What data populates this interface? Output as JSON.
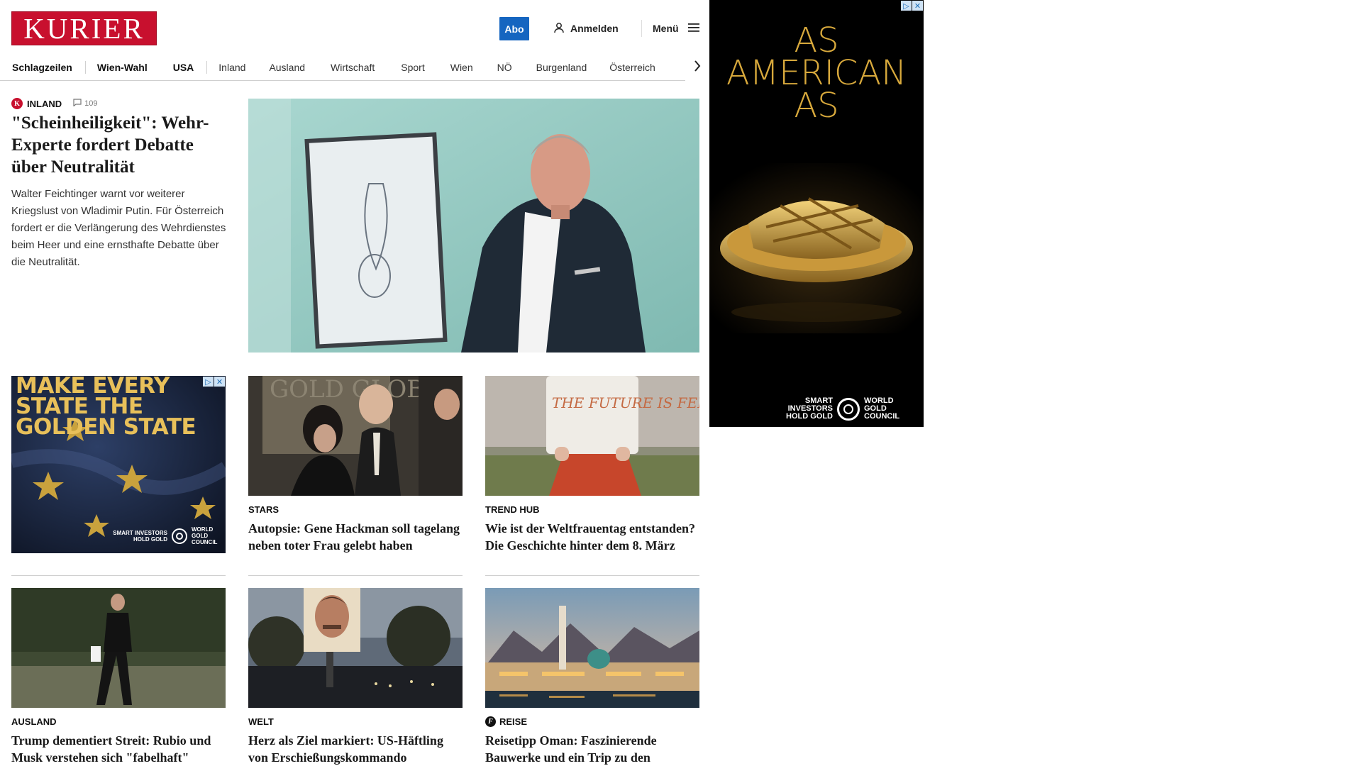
{
  "header": {
    "logo": "KURIER",
    "abo_label": "Abo",
    "login_label": "Anmelden",
    "menu_label": "Menü"
  },
  "nav": {
    "items": [
      "Schlagzeilen",
      "Wien-Wahl",
      "USA",
      "Inland",
      "Ausland",
      "Wirtschaft",
      "Sport",
      "Wien",
      "NÖ",
      "Burgenland",
      "Österreich"
    ]
  },
  "lead": {
    "category": "INLAND",
    "badge_letter": "K",
    "comments": "109",
    "title": "\"Scheinheiligkeit\": Wehr-Experte fordert Debatte über Neutralität",
    "teaser": "Walter Feichtinger warnt vor weiterer Kriegslust von Wladimir Putin. Für Österreich fordert er die Verlängerung des Wehrdienstes beim Heer und eine ernsthafte Debatte über die Neutralität."
  },
  "cards": [
    {
      "category": "STARS",
      "title": "Autopsie: Gene Hackman soll tagelang neben toter Frau gelebt haben"
    },
    {
      "category": "TREND HUB",
      "title": "Wie ist der Weltfrauentag entstanden? Die Geschichte hinter dem 8. März"
    },
    {
      "category": "AUSLAND",
      "title": "Trump dementiert Streit: Rubio und Musk verstehen sich \"fabelhaft\""
    },
    {
      "category": "WELT",
      "title": "Herz als Ziel markiert: US-Häftling von Erschießungskommando hingerichtet"
    },
    {
      "category": "REISE",
      "title": "Reisetipp Oman: Faszinierende Bauwerke und ein Trip zu den Beduinen"
    }
  ],
  "image_texts": {
    "golden_globe_backdrop": "GOLD GLOB AWARD",
    "pillow_text": "THE FUTURE IS FEMALE"
  },
  "ads": {
    "left": {
      "headline": "MAKE EVERY STATE THE GOLDEN STATE",
      "tagline": "SMART INVESTORS HOLD GOLD",
      "brand": "WORLD GOLD COUNCIL"
    },
    "right": {
      "headline": "AS AMERICAN AS",
      "tagline": "SMART INVESTORS HOLD GOLD",
      "brand": "WORLD GOLD COUNCIL"
    },
    "adchoices_glyph": "▷",
    "close_glyph": "✕"
  },
  "colors": {
    "brand_red": "#c8102e",
    "abo_blue": "#1565c0",
    "gold": "#d8a93c"
  }
}
